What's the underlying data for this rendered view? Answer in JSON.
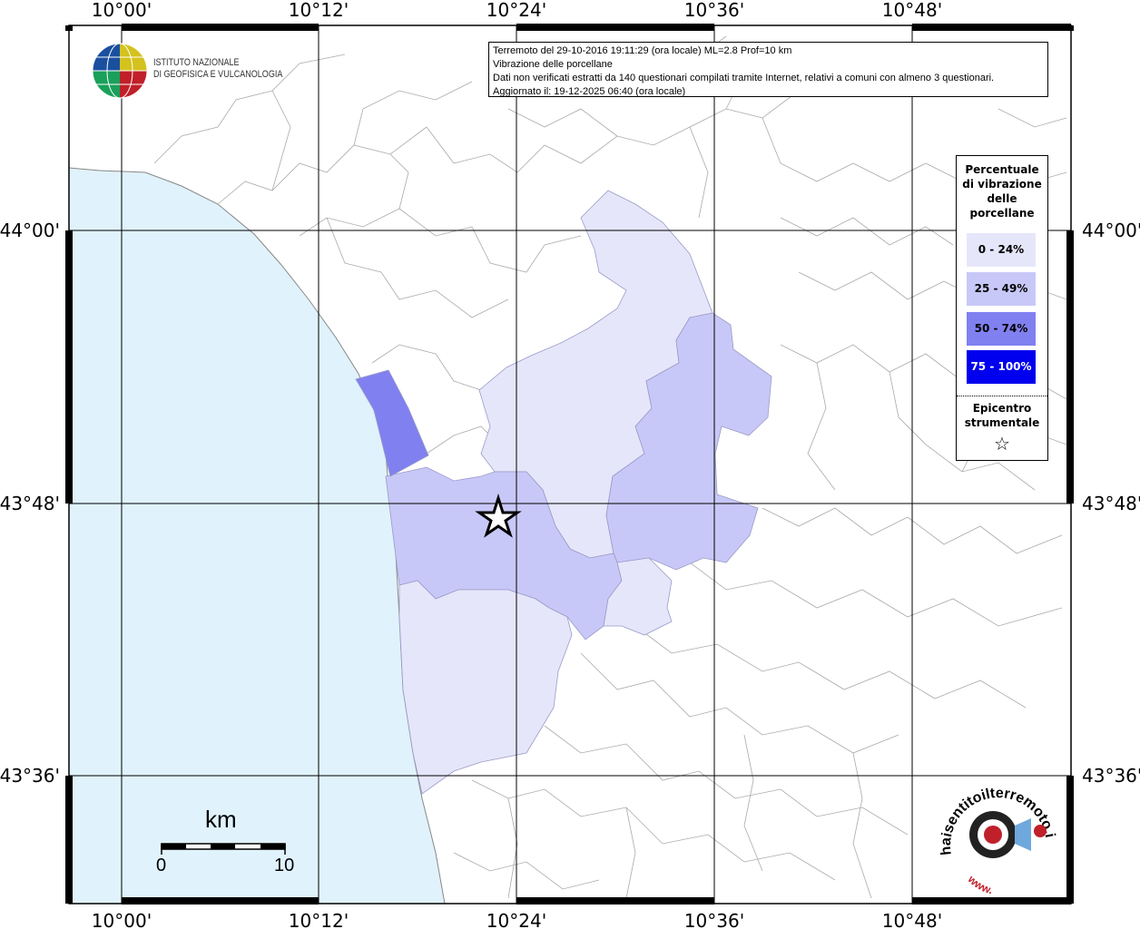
{
  "map": {
    "lon_labels": [
      "10°00'",
      "10°12'",
      "10°24'",
      "10°36'",
      "10°48'"
    ],
    "lat_labels": [
      "44°00'",
      "43°48'",
      "43°36'"
    ]
  },
  "info": {
    "line1": "Terremoto del 29-10-2016 19:11:29 (ora locale) ML=2.8 Prof=10 km",
    "line2": "Vibrazione delle porcellane",
    "line3": "Dati non verificati estratti da 140 questionari compilati tramite Internet, relativi a comuni con almeno 3 questionari.",
    "line4": "Aggiornato il: 19-12-2025 06:40 (ora locale)"
  },
  "institute": {
    "line1": "ISTITUTO NAZIONALE",
    "line2": "DI GEOFISICA E VULCANOLOGIA"
  },
  "legend": {
    "title": [
      "Percentuale",
      "di vibrazione",
      "delle",
      "porcellane"
    ],
    "classes": [
      {
        "label": "0 - 24%",
        "color": "#e6e6fa"
      },
      {
        "label": "25 - 49%",
        "color": "#c8c8f8"
      },
      {
        "label": "50 - 74%",
        "color": "#8080f0"
      },
      {
        "label": "75 - 100%",
        "color": "#0000ee"
      }
    ],
    "epicenter_label": [
      "Epicentro",
      "strumentale"
    ],
    "epicenter_symbol": "☆"
  },
  "scale": {
    "unit": "km",
    "min": "0",
    "max": "10"
  },
  "brand": {
    "text": "haisentitoilterremoto.it",
    "www": "www."
  },
  "colors": {
    "sea": "#e0f2fb",
    "class1": "#e6e6fa",
    "class2": "#c8c8f8",
    "class3": "#8080f0",
    "class4": "#0000ee"
  }
}
